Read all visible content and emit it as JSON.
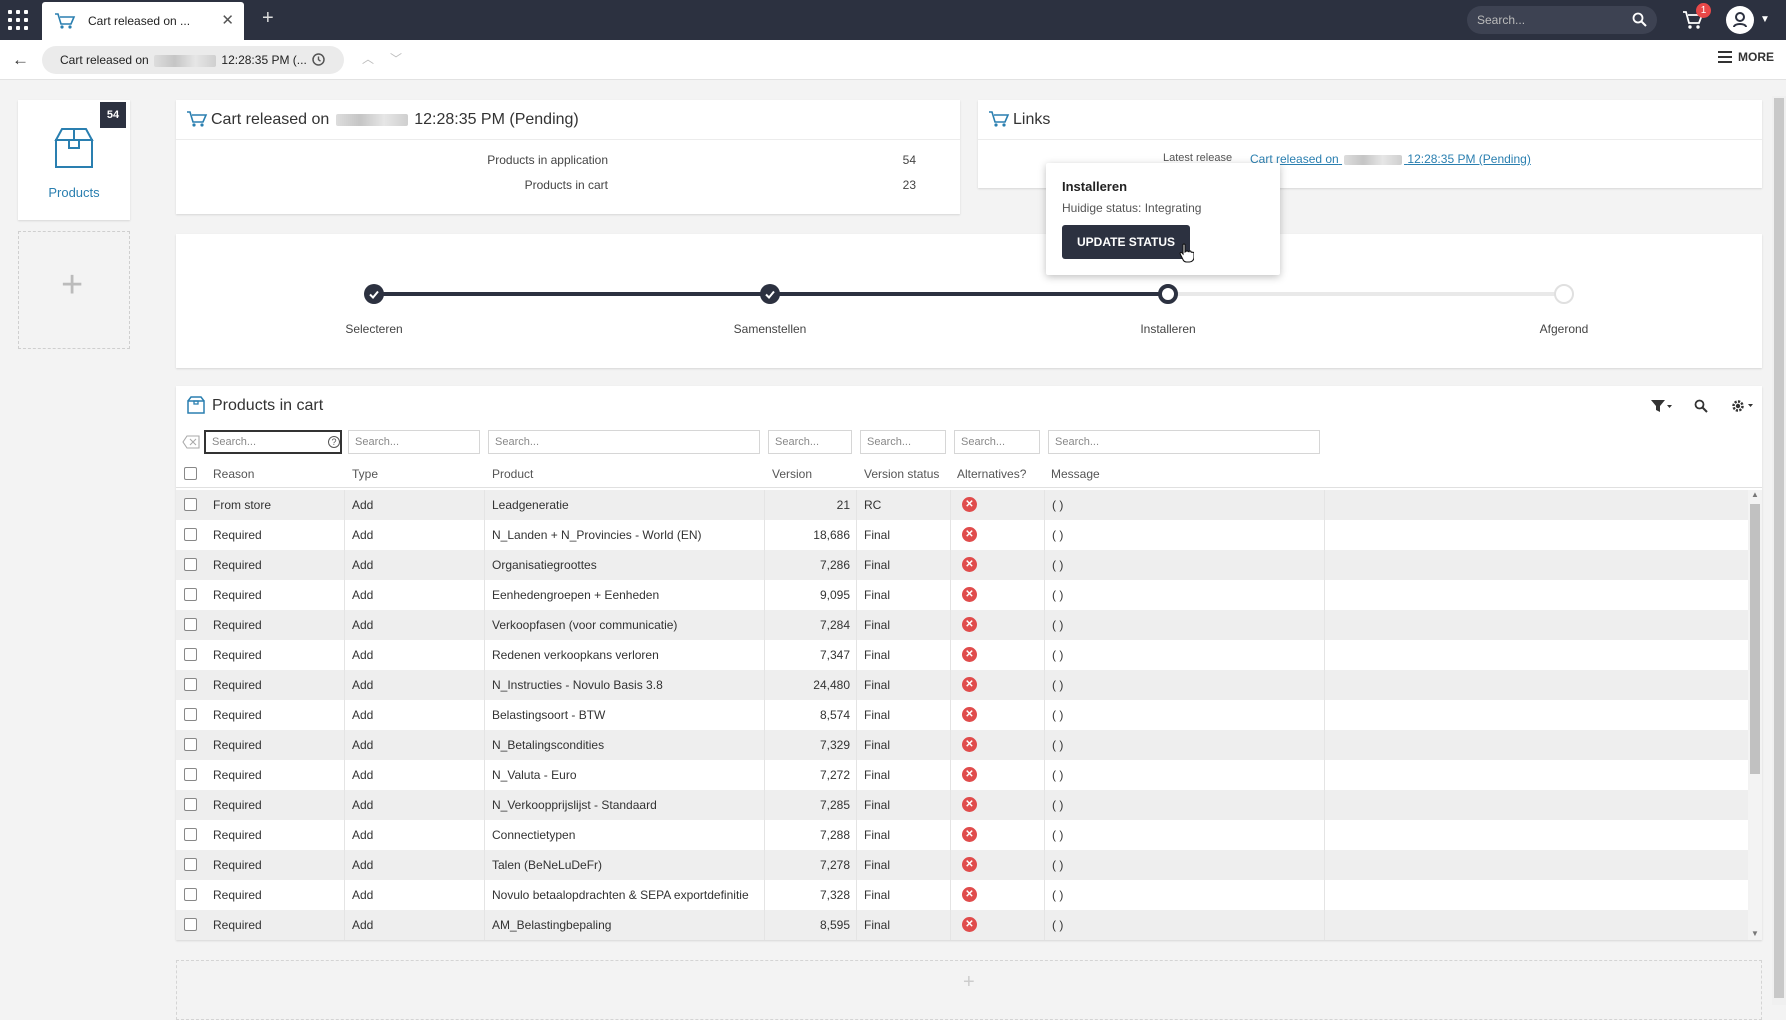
{
  "topbar": {
    "tab_label": "Cart released on ...",
    "search_placeholder": "Search...",
    "cart_badge": "1"
  },
  "subbar": {
    "breadcrumb_label": "Cart released on",
    "breadcrumb_time": "12:28:35 PM (...",
    "more_label": "MORE"
  },
  "sidebar": {
    "products_label": "Products",
    "products_count": "54"
  },
  "summary": {
    "title_prefix": "Cart released on",
    "title_suffix": "12:28:35 PM (Pending)",
    "rows": [
      {
        "label": "Products in application",
        "value": "54"
      },
      {
        "label": "Products in cart",
        "value": "23"
      }
    ]
  },
  "links": {
    "title": "Links",
    "latest_label": "Latest release",
    "link_prefix": "Cart released on",
    "link_suffix": "12:28:35 PM (Pending)"
  },
  "popover": {
    "title": "Installeren",
    "status": "Huidige status: Integrating",
    "button": "UPDATE STATUS"
  },
  "steps": [
    {
      "label": "Selecteren",
      "state": "done"
    },
    {
      "label": "Samenstellen",
      "state": "done"
    },
    {
      "label": "Installeren",
      "state": "current"
    },
    {
      "label": "Afgerond",
      "state": "todo"
    }
  ],
  "table": {
    "title": "Products in cart",
    "search_placeholder": "Search...",
    "columns": [
      "Reason",
      "Type",
      "Product",
      "Version",
      "Version status",
      "Alternatives?",
      "Message"
    ],
    "rows": [
      {
        "reason": "From store",
        "type": "Add",
        "product": "Leadgeneratie",
        "version": "21",
        "status": "RC",
        "message": "( )"
      },
      {
        "reason": "Required",
        "type": "Add",
        "product": "N_Landen + N_Provincies - World (EN)",
        "version": "18,686",
        "status": "Final",
        "message": "( )"
      },
      {
        "reason": "Required",
        "type": "Add",
        "product": "Organisatiegroottes",
        "version": "7,286",
        "status": "Final",
        "message": "( )"
      },
      {
        "reason": "Required",
        "type": "Add",
        "product": "Eenhedengroepen + Eenheden",
        "version": "9,095",
        "status": "Final",
        "message": "( )"
      },
      {
        "reason": "Required",
        "type": "Add",
        "product": "Verkoopfasen (voor communicatie)",
        "version": "7,284",
        "status": "Final",
        "message": "( )"
      },
      {
        "reason": "Required",
        "type": "Add",
        "product": "Redenen verkoopkans verloren",
        "version": "7,347",
        "status": "Final",
        "message": "( )"
      },
      {
        "reason": "Required",
        "type": "Add",
        "product": "N_Instructies - Novulo Basis 3.8",
        "version": "24,480",
        "status": "Final",
        "message": "( )"
      },
      {
        "reason": "Required",
        "type": "Add",
        "product": "Belastingsoort - BTW",
        "version": "8,574",
        "status": "Final",
        "message": "( )"
      },
      {
        "reason": "Required",
        "type": "Add",
        "product": "N_Betalingscondities",
        "version": "7,329",
        "status": "Final",
        "message": "( )"
      },
      {
        "reason": "Required",
        "type": "Add",
        "product": "N_Valuta - Euro",
        "version": "7,272",
        "status": "Final",
        "message": "( )"
      },
      {
        "reason": "Required",
        "type": "Add",
        "product": "N_Verkoopprijslijst - Standaard",
        "version": "7,285",
        "status": "Final",
        "message": "( )"
      },
      {
        "reason": "Required",
        "type": "Add",
        "product": "Connectietypen",
        "version": "7,288",
        "status": "Final",
        "message": "( )"
      },
      {
        "reason": "Required",
        "type": "Add",
        "product": "Talen (BeNeLuDeFr)",
        "version": "7,278",
        "status": "Final",
        "message": "( )"
      },
      {
        "reason": "Required",
        "type": "Add",
        "product": "Novulo betaalopdrachten & SEPA exportdefinitie",
        "version": "7,328",
        "status": "Final",
        "message": "( )"
      },
      {
        "reason": "Required",
        "type": "Add",
        "product": "AM_Belastingbepaling",
        "version": "8,595",
        "status": "Final",
        "message": "( )"
      }
    ]
  },
  "colors": {
    "dark": "#2c3140",
    "accent": "#2a7fb0",
    "error": "#e04c4c"
  }
}
